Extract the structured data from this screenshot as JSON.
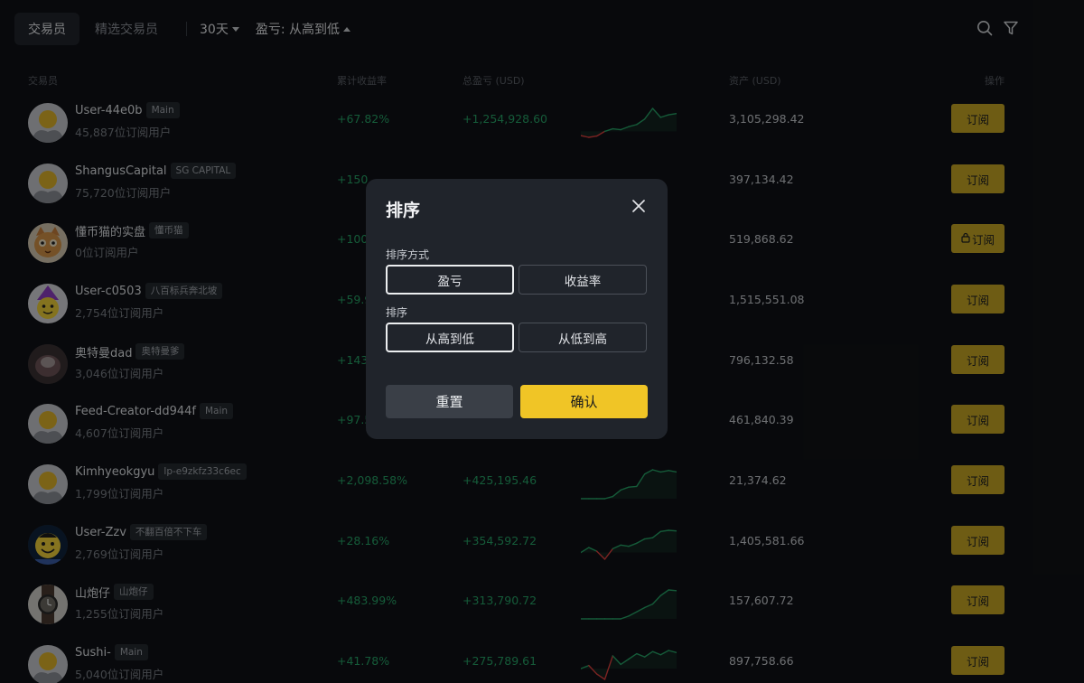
{
  "tabs": [
    {
      "label": "交易员",
      "active": true
    },
    {
      "label": "精选交易员",
      "active": false
    }
  ],
  "filters": {
    "period": "30天",
    "sort": "盈亏: 从高到低"
  },
  "icons": {
    "search": "search-icon",
    "filter": "filter-icon"
  },
  "columns": {
    "trader": "交易员",
    "roi": "累计收益率",
    "pnl": "总盈亏 (USD)",
    "assets": "资产 (USD)",
    "action": "操作"
  },
  "rows": [
    {
      "name": "User-44e0b",
      "badge": "Main",
      "subs": "45,887位订阅用户",
      "roi": "+67.82%",
      "pnl": "+1,254,928.60",
      "assets": "3,105,298.42",
      "btn": "订阅",
      "locked": false,
      "avatar": "default",
      "spark": [
        -1,
        -1.4,
        -1.1,
        0,
        0.6,
        0.4,
        1.1,
        1.6,
        2.9,
        5.4,
        3.3,
        3.9,
        4.2
      ]
    },
    {
      "name": "ShangusCapital",
      "badge": "SG CAPITAL",
      "subs": "75,720位订阅用户",
      "roi": "+150.",
      "pnl": "",
      "assets": "397,134.42",
      "btn": "订阅",
      "locked": false,
      "avatar": "default",
      "spark": []
    },
    {
      "name": "懂币猫的实盘",
      "badge": "懂币猫",
      "subs": "0位订阅用户",
      "roi": "+100.",
      "pnl": "",
      "assets": "519,868.62",
      "btn": "订阅",
      "locked": true,
      "avatar": "cat",
      "spark": []
    },
    {
      "name": "User-c0503",
      "badge": "八百标兵奔北坡",
      "subs": "2,754位订阅用户",
      "roi": "+59.9",
      "pnl": "",
      "assets": "1,515,551.08",
      "btn": "订阅",
      "locked": false,
      "avatar": "wizard",
      "spark": []
    },
    {
      "name": "奥特曼dad",
      "badge": "奥特曼爹",
      "subs": "3,046位订阅用户",
      "roi": "+143.",
      "pnl": "",
      "assets": "796,132.58",
      "btn": "订阅",
      "locked": false,
      "avatar": "dark",
      "spark": []
    },
    {
      "name": "Feed-Creator-dd944f",
      "badge": "Main",
      "subs": "4,607位订阅用户",
      "roi": "+97.5",
      "pnl": "",
      "assets": "461,840.39",
      "btn": "订阅",
      "locked": false,
      "avatar": "default",
      "spark": []
    },
    {
      "name": "Kimhyeokgyu",
      "badge": "lp-e9zkfz33c6ec",
      "subs": "1,799位订阅用户",
      "roi": "+2,098.58%",
      "pnl": "+425,195.46",
      "assets": "21,374.62",
      "btn": "订阅",
      "locked": false,
      "avatar": "default",
      "spark": [
        0,
        0,
        0,
        0,
        0.3,
        1.2,
        1.6,
        1.7,
        3.4,
        4.0,
        3.7,
        3.9,
        3.7
      ]
    },
    {
      "name": "User-Zzv",
      "badge": "不翻百倍不下车",
      "subs": "2,769位订阅用户",
      "roi": "+28.16%",
      "pnl": "+354,592.72",
      "assets": "1,405,581.66",
      "btn": "订阅",
      "locked": false,
      "avatar": "smiley",
      "spark": [
        0,
        0.8,
        0.2,
        -1.1,
        0.6,
        1.2,
        1.0,
        1.5,
        2.2,
        2.4,
        3.4,
        3.6,
        3.5
      ]
    },
    {
      "name": "山炮仔",
      "badge": "山炮仔",
      "subs": "1,255位订阅用户",
      "roi": "+483.99%",
      "pnl": "+313,790.72",
      "assets": "157,607.72",
      "btn": "订阅",
      "locked": false,
      "avatar": "watch",
      "spark": [
        0,
        0,
        0,
        0,
        0,
        0,
        0.4,
        1.0,
        1.6,
        2.1,
        3.3,
        4.1,
        4.0
      ]
    },
    {
      "name": "Sushi-",
      "badge": "Main",
      "subs": "5,040位订阅用户",
      "roi": "+41.78%",
      "pnl": "+275,789.61",
      "assets": "897,758.66",
      "btn": "订阅",
      "locked": false,
      "avatar": "default",
      "spark": [
        0,
        0.3,
        -0.5,
        -1.0,
        1.2,
        0.4,
        0.9,
        1.4,
        1.1,
        1.6,
        1.3,
        1.7,
        1.5
      ]
    }
  ],
  "modal": {
    "title": "排序",
    "method_label": "排序方式",
    "method_options": [
      {
        "label": "盈亏",
        "selected": true
      },
      {
        "label": "收益率",
        "selected": false
      }
    ],
    "order_label": "排序",
    "order_options": [
      {
        "label": "从高到低",
        "selected": true
      },
      {
        "label": "从低到高",
        "selected": false
      }
    ],
    "reset": "重置",
    "confirm": "确认"
  },
  "colors": {
    "accent": "#f0c526",
    "subscribe": "#c9a826",
    "positive": "#27a669",
    "negative": "#e0413f",
    "panel": "#20242b"
  }
}
